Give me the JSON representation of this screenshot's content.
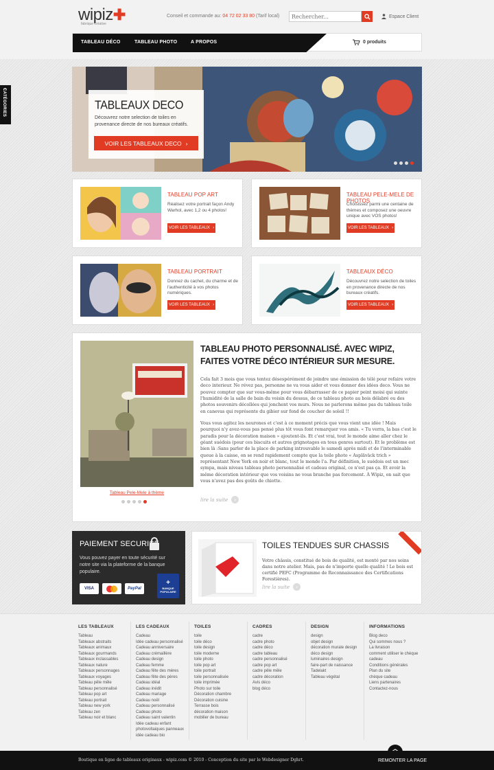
{
  "header": {
    "logo_text": "wipiz",
    "logo_tagline": "fabrique créative",
    "contact_label": "Conseil et commande au:",
    "contact_phone": "04 72 02 33 80",
    "contact_note": "(Tarif local)",
    "search_placeholder": "Rechercher...",
    "account_label": "Espace Client"
  },
  "nav": {
    "items": [
      "TABLEAU DÉCO",
      "TABLEAU PHOTO",
      "A PROPOS"
    ],
    "cart_label": "0 produits"
  },
  "side_tab": {
    "label": "CATÉGORIES"
  },
  "hero": {
    "title": "TABLEAUX DECO",
    "text": "Découvrez notre selection de toiles en provenance directe de nos bureaux créatifs.",
    "button": "VOIR LES TABLEAUX DECO"
  },
  "cards": [
    {
      "title": "TABLEAU POP ART",
      "text": "Réalisez votre portrait façon Andy Warhol, avec 1,2 ou 4 photos!",
      "button": "VOIR LES TABLEAUX"
    },
    {
      "title": "TABLEAU PELE-MELE DE PHOTOS",
      "text": "Choisissez parmi une centaine de thèmes et composez une oeuvre unique avec VOS photos!",
      "button": "VOIR LES TABLEAUX"
    },
    {
      "title": "TABLEAU PORTRAIT",
      "text": "Donnez du cachet, du charme et de l'authenticité à vos photos numériques.",
      "button": "VOIR LES TABLEAUX"
    },
    {
      "title": "TABLEAUX DÉCO",
      "text": "Découvrez notre selection de toiles en provenance directe de nos bureaux créatifs.",
      "button": "VOIR LES TABLEAUX"
    }
  ],
  "article": {
    "title": "TABLEAU PHOTO PERSONNALISÉ. AVEC WIPIZ, FAITES VOTRE DÉCO INTÉRIEUR SUR MESURE.",
    "paragraph1": "Cela fait 3 mois que vous tentez désespérément de joindre une émission de télé pour refaire votre deco interieur. Ne révez pas, personne ne va vous aider et vous donner des idées deco. Vous ne pouvez compter que sur vous-même pour vous débarrasser de ce papier peint moisi qui suinte l'humidité de la salle de bain du voisin du dessus, de ce tableau photo au bois délabré ou des photos souvenirs décollées qui jonchent vos murs. Nous ne parlerons même pas du tableau toile en canevas qui représente du gibier sur fond de coucher de soleil !!",
    "paragraph2": "Vous vous agitez les neurones et c'est à ce moment précis que vous vient une idée ! Mais pourquoi n'y avez-vous pas pensé plus tôt vous font remarquer vos amis. « Tu verra, la bas c'est le paradis pour la décoration maison » ajoutent-ils. Et c'est vrai, tout le monde aime aller chez le géant suédois (pour ces biscuits et autres grignotages en tous genres surtout). Et le problème est bien là :Sans parler de la place de parking introuvable le samedi après midi et de l'interminable queue à la caisse, on se rend rapidement compte que la toile photo « Aspläväck trich » représentant  New York en noir et blanc, tout le monde l'a. Par définition, le suédois est un mec sympa, mais niveau tableau photo personnalisé et cadeau original, ce n'est pas ça. Et avoir la même décoration intérieur que vos voisins ne vous branche pas forcement. À Wipiz, on sait que vous n'avez pas des goûts de chiotte.",
    "image_caption": "Tableau Pele-Mele à thème",
    "read_more": "lire la suite"
  },
  "payment": {
    "title": "PAIEMENT SECURISE",
    "text": "Vous pouvez payer en toute sécurité sur notre site via la plateforme de la banque populaire.",
    "logos": [
      "VISA",
      "MasterCard",
      "PayPal",
      "BANQUE POPULAIRE"
    ]
  },
  "toiles": {
    "title": "TOILES TENDUES SUR CHASSIS",
    "text": "Votre châssis, constitué de bois de qualité, est monté par nos soins dans notre atelier. Mais, pas de n'importe quelle qualité ! Le bois est certifié PEFC (Programme de Reconnaissance des Certifications Forestières).",
    "read_more": "lire la suite"
  },
  "footer": {
    "columns": [
      {
        "title": "LES TABLEAUX",
        "items": [
          "Tableau",
          "Tableaux abstraits",
          "Tableaux animaux",
          "Tableaux gourmands",
          "Tableaux inclassables",
          "Tableaux nature",
          "Tableaux personnages",
          "Tableaux voyages",
          "Tableau pêle mêle",
          "Tableau personnalisé",
          "Tableau pop art",
          "Tableau portrait",
          "Tableau new york",
          "Tableau zen",
          "Tableau noir et blanc"
        ]
      },
      {
        "title": "LES CADEAUX",
        "items": [
          "Cadeau",
          "Idée cadeau personnalisé",
          "Cadeau anniversaire",
          "Cadeau crémaillère",
          "Cadeau design",
          "Cadeau femme",
          "Cadeau fête des mères",
          "Cadeau fête des pères",
          "Cadeau idéal",
          "Cadeau inédit",
          "Cadeau mariage",
          "Cadeau noël",
          "Cadeau personnalisé",
          "Cadeau photo",
          "Cadeau saint valentin",
          "Idée cadeau enfant",
          "photovoltaiques panneaux",
          "idée cadeau bio"
        ]
      },
      {
        "title": "TOILES",
        "items": [
          "toile",
          "toile déco",
          "toile design",
          "toile moderne",
          "toile photo",
          "toile pop art",
          "toile portrait",
          "toile personnalisée",
          "toile imprimée",
          "Photo sur toile",
          "Décoration chambre",
          "Décoration cuisine",
          "Terrasse bois",
          "décoration maison",
          "mobilier de bureau"
        ]
      },
      {
        "title": "CADRES",
        "items": [
          "cadre",
          "cadre photo",
          "cadre déco",
          "cadre tableau",
          "cadre personnalisé",
          "cadre pop art",
          "cadre pêle mêle",
          "cadre décoration",
          "Avis déco",
          "blog déco"
        ]
      },
      {
        "title": "DESIGN",
        "items": [
          "design",
          "objet design",
          "décoration murale design",
          "déco design",
          "luminaires design",
          "faire-part de naissance",
          "Tadelakt",
          "Tableau végétal"
        ]
      },
      {
        "title": "INFORMATIONS",
        "items": [
          "Blog deco",
          "Qui sommes nous ?",
          "La livraison",
          "comment utiliser le chèque cadeau",
          "Conditions générales",
          "Plan du site",
          "chèque cadeau",
          "Liens partenaires",
          "Contactez-nous"
        ]
      }
    ],
    "copyright": "Boutique en ligne de tableaux originaux - wipiz.com © 2010 - Conception du site par le Webdesigner Dghrt.",
    "back_to_top": "REMONTER LA PAGE"
  }
}
